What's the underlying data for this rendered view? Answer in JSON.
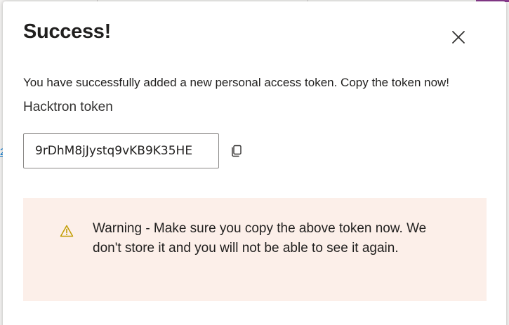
{
  "dialog": {
    "title": "Success!",
    "message": "You have successfully added a new personal access token. Copy the token now!",
    "token_name": "Hacktron token",
    "token_value": "9rDhM8jJystq9vKB9K35HE",
    "warning_text": "Warning - Make sure you copy the above token now. We don't store it and you will not be able to see it again."
  },
  "icons": {
    "close": "close-icon",
    "copy": "copy-icon",
    "warning": "warning-icon"
  },
  "colors": {
    "warning_background": "#fcefe9",
    "warning_icon": "#c19c00",
    "page_background": "#f3f2f1",
    "accent": "#8b3a8f"
  }
}
